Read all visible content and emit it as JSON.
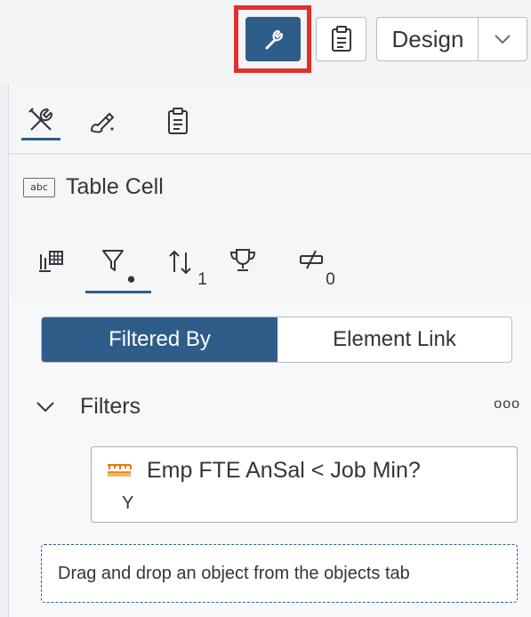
{
  "toolbar": {
    "design_label": "Design",
    "wrench_icon": "wrench-icon",
    "clipboard_icon": "clipboard-icon",
    "chevron_icon": "chevron-down-icon",
    "highlight_color": "#e0302c",
    "accent_color": "#2f5d8a"
  },
  "panel_tabs": {
    "tools_icon": "tools-icon",
    "styling_icon": "paintbrush-icon",
    "clipboard_icon": "clipboard-icon"
  },
  "object": {
    "type_badge": "abc",
    "label": "Table Cell"
  },
  "sub_tabs": {
    "items": [
      {
        "icon": "columns-icon",
        "badge": ""
      },
      {
        "icon": "filter-icon",
        "badge": "●"
      },
      {
        "icon": "sort-icon",
        "badge": "1"
      },
      {
        "icon": "trophy-icon",
        "badge": ""
      },
      {
        "icon": "break-icon",
        "badge": "0"
      }
    ]
  },
  "segmented": {
    "filtered_by": "Filtered By",
    "element_link": "Element Link"
  },
  "filters": {
    "header": "Filters",
    "more": "ooo",
    "items": [
      {
        "icon": "measure-icon",
        "text": "Emp FTE AnSal  <  Job Min?",
        "text2": "Y"
      }
    ],
    "drop_hint": "Drag and drop an object from the objects tab"
  }
}
